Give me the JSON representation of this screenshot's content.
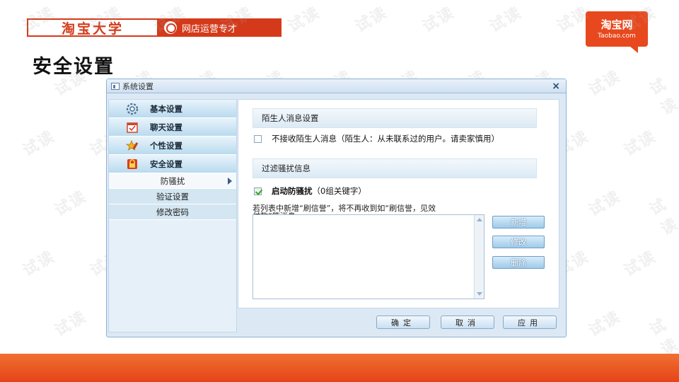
{
  "banner": {
    "brand": "淘宝大学",
    "subtitle": "网店运营专才"
  },
  "logo": {
    "cn": "淘宝网",
    "en": "Taobao.com"
  },
  "page": {
    "title": "安全设置"
  },
  "window": {
    "title": "系统设置",
    "close": "×"
  },
  "sidebar": {
    "items": [
      {
        "label": "基本设置",
        "icon": "gear-icon"
      },
      {
        "label": "聊天设置",
        "icon": "chat-calendar-icon"
      },
      {
        "label": "个性设置",
        "icon": "star-pencil-icon"
      },
      {
        "label": "安全设置",
        "icon": "lock-icon"
      }
    ],
    "sub_items": [
      {
        "label": "防骚扰",
        "active": true
      },
      {
        "label": "验证设置",
        "active": false
      },
      {
        "label": "修改密码",
        "active": false
      }
    ]
  },
  "stranger": {
    "heading": "陌生人消息设置",
    "checkbox_label": "不接收陌生人消息（陌生人：从未联系过的用户。请卖家慎用）",
    "checked": false
  },
  "filter": {
    "heading": "过滤骚扰信息",
    "enable_label": "启动防骚扰",
    "enable_count": "（0组关键字）",
    "enabled": true,
    "hint_line1": "若列表中新增“刷信誉”，将不再收到如“刷信誉，见效",
    "hint_line2": "付款”等消息。",
    "keywords": []
  },
  "side_buttons": {
    "add": "新增",
    "edit": "修改",
    "delete": "删除"
  },
  "bottom_buttons": {
    "ok": "确定",
    "cancel": "取消",
    "apply": "应用"
  },
  "watermark": "试读",
  "colors": {
    "brand_red": "#d43a1a",
    "footer_orange": "#e54418",
    "window_bg": "#dce9f5"
  }
}
